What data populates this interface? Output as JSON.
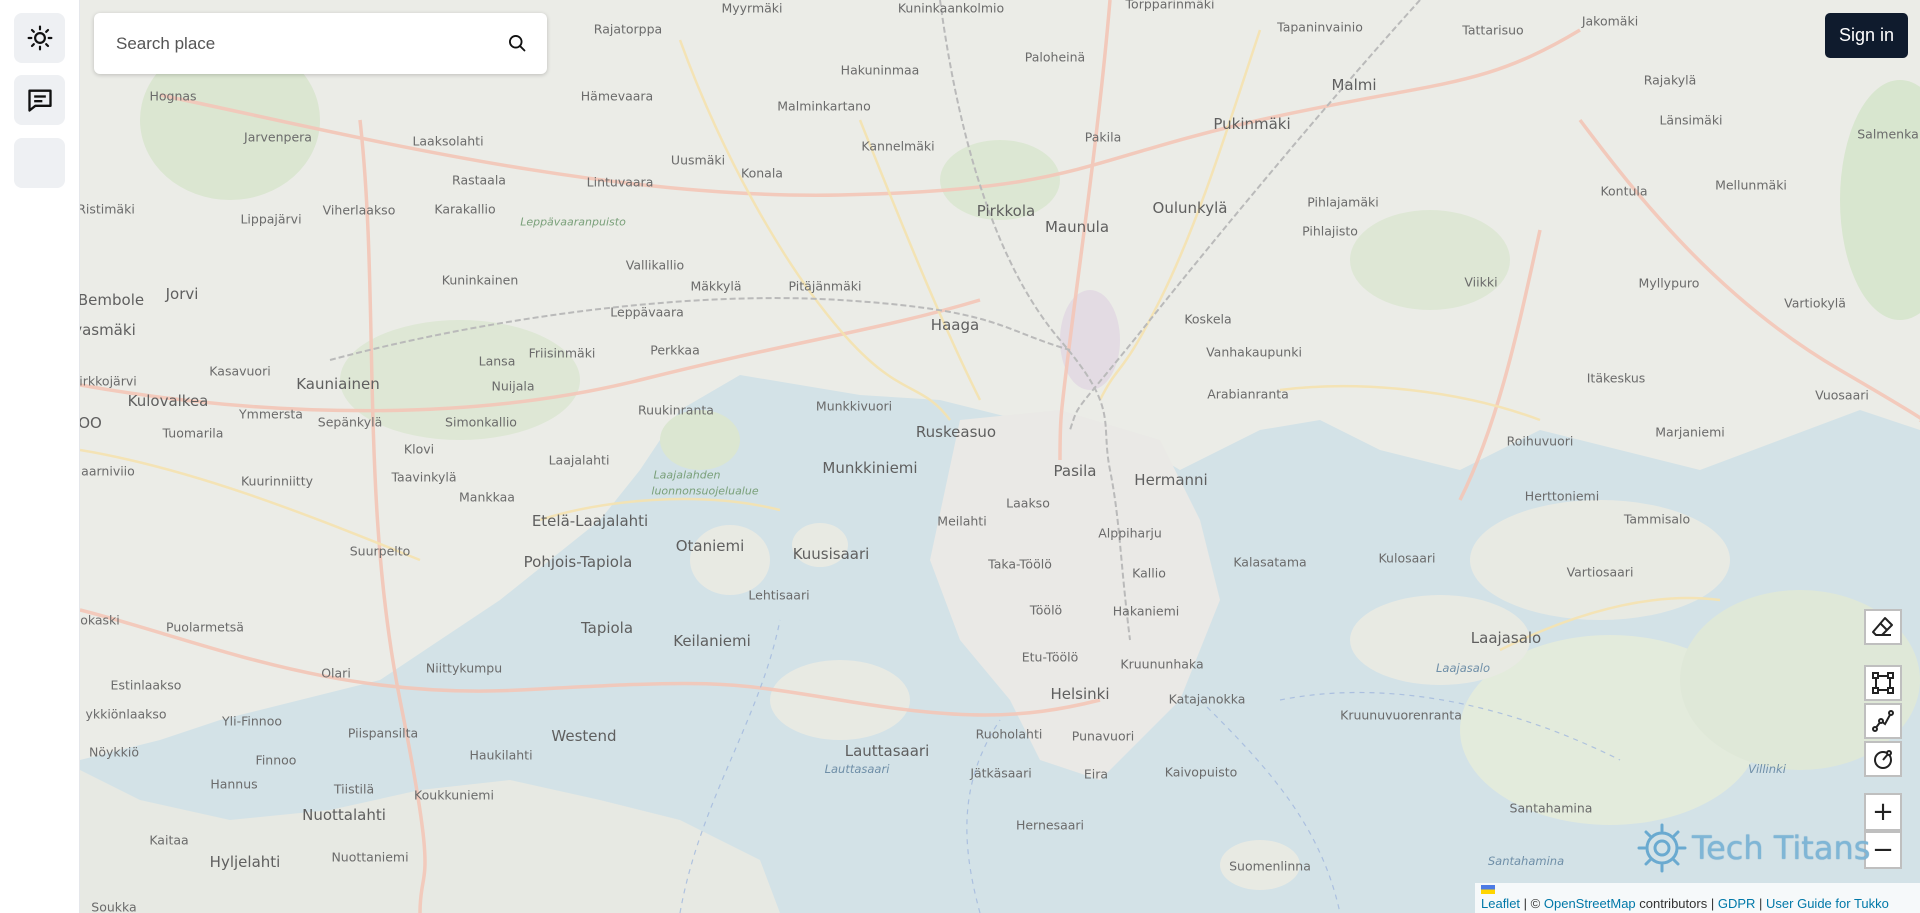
{
  "search": {
    "placeholder": "Search place"
  },
  "auth": {
    "signin_label": "Sign in"
  },
  "sidebar": {
    "items": [
      {
        "icon": "sun-icon"
      },
      {
        "icon": "chat-icon"
      },
      {
        "icon": "blank"
      }
    ]
  },
  "map": {
    "labels": {
      "myyrmaki": "Myyrmäki",
      "kuninkaankolmio": "Kuninkaankolmio",
      "torpparinmaki": "Torpparinmäki",
      "tapaninvainio": "Tapaninvainio",
      "tattarisuo": "Tattarisuo",
      "jakomaki": "Jakomäki",
      "rajatorppa": "Rajatorppa",
      "hakuninmaa": "Hakuninmaa",
      "paloheina": "Paloheinä",
      "malmi": "Malmi",
      "rajakyla": "Rajakylä",
      "hognas": "Hognas",
      "jarvenpera": "Jarvenpera",
      "hamevaara": "Hämevaara",
      "malminkartano": "Malminkartano",
      "pukinmaki": "Pukinmäki",
      "lansimaki": "Länsimäki",
      "salmenkallio": "Salmenka",
      "laaksolahti": "Laaksolahti",
      "uusmaki": "Uusmäki",
      "kannelmaki": "Kannelmäki",
      "pakila": "Pakila",
      "konala": "Konala",
      "rastaala": "Rastaala",
      "lintuvaara": "Lintuvaara",
      "pirkkola": "Pirkkola",
      "pihlajamaki": "Pihlajamäki",
      "kontula": "Kontula",
      "mellunmaki": "Mellunmäki",
      "ristimaki": "Ristimäki",
      "maunula": "Maunula",
      "pihlajisto": "Pihlajisto",
      "leppavaaranpuisto": "Leppävaaranpuisto",
      "lippajarvi": "Lippajärvi",
      "viherlaakso": "Viherlaakso",
      "karakallio": "Karakallio",
      "vallikallio": "Vallikallio",
      "oulunkyla": "Oulunkylä",
      "kuninkainen": "Kuninkainen",
      "viikki": "Viikki",
      "bembole": "Bembole",
      "jorvi": "Jorvi",
      "makkyla": "Mäkkylä",
      "pitajanmaki": "Pitäjänmäki",
      "myllypuro": "Myllypuro",
      "vartiokyla": "Vartiokylä",
      "haaga": "Haaga",
      "leppavaara": "Leppävaara",
      "koskela": "Koskela",
      "karvasmaki": "Karvasmäki",
      "kasavuori": "Kasavuori",
      "friisinmaki": "Friisinmäki",
      "perkkaa": "Perkkaa",
      "vanhakaupunki": "Vanhakaupunki",
      "lansa": "Lansa",
      "irkkojarvi": "irkkojärvi",
      "kauniainen": "Kauniainen",
      "nuijala": "Nuijala",
      "itakeskus": "Itäkeskus",
      "arabianranta": "Arabianranta",
      "kulovalkea": "Kulovalkea",
      "ruukinranta": "Ruukinranta",
      "munkkivuori": "Munkkivuori",
      "vuosaari": "Vuosaari",
      "ymmersta": "Ymmersta",
      "oo": "OO",
      "sepankyla": "Sepänkylä",
      "simonkallio": "Simonkallio",
      "tuomarila": "Tuomarila",
      "ruskeasuo": "Ruskeasuo",
      "marjaniemi": "Marjaniemi",
      "klovi": "Klovi",
      "roihuvuori": "Roihuvuori",
      "laajalahti": "Laajalahti",
      "munkkiniemi": "Munkkiniemi",
      "pasila": "Pasila",
      "hermanni": "Hermanni",
      "aurinkivio": "aarniviio",
      "kuurinniitty": "Kuurinniitty",
      "taavinkyla": "Taavinkylä",
      "laajalahden": "Laajalahden",
      "luonnonsuojelualue": "luonnonsuojelualue",
      "mankkaa": "Mankkaa",
      "laakso": "Laakso",
      "herttoniemi": "Herttoniemi",
      "etelalaajalahti": "Etelä-Laajalahti",
      "meilahti": "Meilahti",
      "tammisalo": "Tammisalo",
      "alppiharju": "Alppiharju",
      "suurpelto": "Suurpelto",
      "otaniemi": "Otaniemi",
      "kuusisaari": "Kuusisaari",
      "pohjoistapiola": "Pohjois-Tapiola",
      "tukholo": "Taka-Töölö",
      "kalasatama": "Kalasatama",
      "kulosaari": "Kulosaari",
      "kallio": "Kallio",
      "vartiosaari": "Vartiosaari",
      "lehtisaari": "Lehtisaari",
      "toolo": "Töölö",
      "hakaniemi": "Hakaniemi",
      "okaski": "okaski",
      "puolarmetsa": "Puolarmetsä",
      "tapiola": "Tapiola",
      "laajasalo": "Laajasalo",
      "keilaniemi": "Keilaniemi",
      "etutoolo": "Etu-Töölö",
      "kruununhaka": "Kruununhaka",
      "laajasalo_water": "Laajasalo",
      "niittykumpu": "Niittykumpu",
      "estinlaakso": "Estinlaakso",
      "olari": "Olari",
      "helsinki": "Helsinki",
      "katajanokka": "Katajanokka",
      "kruunuvuorenranta": "Kruunuvuorenranta",
      "vykkionlaakso": "ykkiönlaakso",
      "ylifinnoo": "Yli-Finnoo",
      "pisapansalta": "Piispansilta",
      "westend": "Westend",
      "lauttasaari": "Lauttasaari",
      "ruoholahti": "Ruoholahti",
      "punavuori": "Punavuori",
      "lauttasaari_water": "Lauttasaari",
      "noykkio": "Nöykkiö",
      "finnoo": "Finnoo",
      "haukilahti": "Haukilahti",
      "jatkasaari": "Jätkäsaari",
      "eira": "Eira",
      "kaivopuisto": "Kaivopuisto",
      "villinki": "Villinki",
      "hannus": "Hannus",
      "tiistila": "Tiistilä",
      "koukkuniemi": "Koukkuniemi",
      "santahamina": "Santahamina",
      "nuottalahti": "Nuottalahti",
      "kaitaa": "Kaitaa",
      "hernesaari": "Hernesaari",
      "santahamina_water": "Santahamina",
      "hyljelahti": "Hyljelahti",
      "nuottaniemi": "Nuottaniemi",
      "suomenlinna": "Suomenlinna",
      "soukka": "Soukka"
    }
  },
  "logo": {
    "text": "Tech Titans"
  },
  "attribution": {
    "leaflet": "Leaflet",
    "sep1": "| ©",
    "osm": "OpenStreetMap",
    "contributors": "contributors |",
    "gdpr": "GDPR",
    "sep2": "|",
    "guide": "User Guide for Tukko"
  }
}
